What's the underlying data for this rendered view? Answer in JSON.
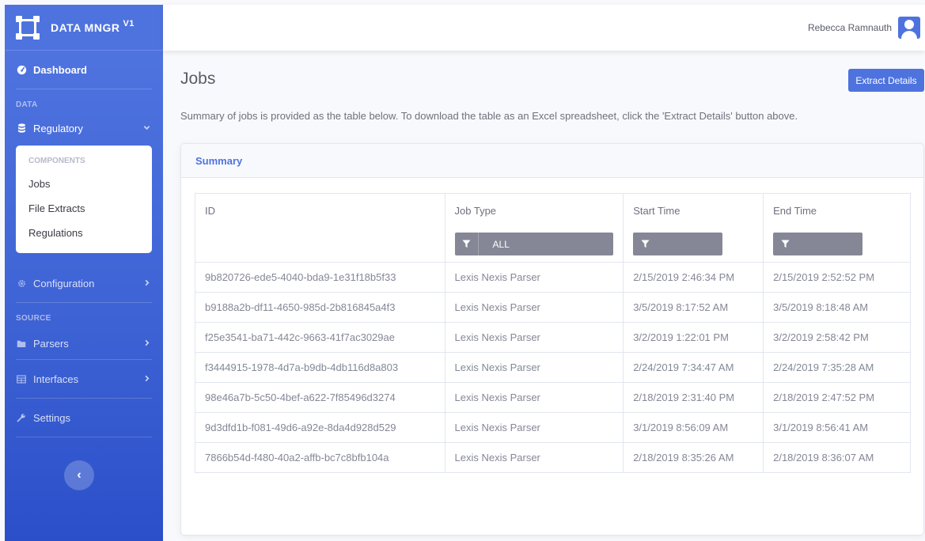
{
  "brand": {
    "name": "DATA MNGR",
    "version": "V1"
  },
  "sidebar": {
    "dashboard": "Dashboard",
    "section_data": "DATA",
    "regulatory": "Regulatory",
    "components_head": "COMPONENTS",
    "components": [
      "Jobs",
      "File Extracts",
      "Regulations"
    ],
    "configuration": "Configuration",
    "section_source": "SOURCE",
    "parsers": "Parsers",
    "interfaces": "Interfaces",
    "settings": "Settings",
    "toggle": "‹"
  },
  "topbar": {
    "user_name": "Rebecca Ramnauth"
  },
  "page": {
    "title": "Jobs",
    "extract_button": "Extract Details",
    "description": "Summary of jobs is provided as the table below. To download the table as an Excel spreadsheet, click the 'Extract Details' button above."
  },
  "card": {
    "title": "Summary"
  },
  "table": {
    "headers": [
      "ID",
      "Job Type",
      "Start Time",
      "End Time"
    ],
    "filters": {
      "job_type": "ALL",
      "start_time": "",
      "end_time": ""
    },
    "rows": [
      [
        "9b820726-ede5-4040-bda9-1e31f18b5f33",
        "Lexis Nexis Parser",
        "2/15/2019 2:46:34 PM",
        "2/15/2019 2:52:52 PM"
      ],
      [
        "b9188a2b-df11-4650-985d-2b816845a4f3",
        "Lexis Nexis Parser",
        "3/5/2019 8:17:52 AM",
        "3/5/2019 8:18:48 AM"
      ],
      [
        "f25e3541-ba71-442c-9663-41f7ac3029ae",
        "Lexis Nexis Parser",
        "3/2/2019 1:22:01 PM",
        "3/2/2019 2:58:42 PM"
      ],
      [
        "f3444915-1978-4d7a-b9db-4db116d8a803",
        "Lexis Nexis Parser",
        "2/24/2019 7:34:47 AM",
        "2/24/2019 7:35:28 AM"
      ],
      [
        "98e46a7b-5c50-4bef-a622-7f85496d3274",
        "Lexis Nexis Parser",
        "2/18/2019 2:31:40 PM",
        "2/18/2019 2:47:52 PM"
      ],
      [
        "9d3dfd1b-f081-49d6-a92e-8da4d928d529",
        "Lexis Nexis Parser",
        "3/1/2019 8:56:09 AM",
        "3/1/2019 8:56:41 AM"
      ],
      [
        "7866b54d-f480-40a2-affb-bc7c8bfb104a",
        "Lexis Nexis Parser",
        "2/18/2019 8:35:26 AM",
        "2/18/2019 8:36:07 AM"
      ]
    ]
  },
  "colors": {
    "primary": "#4e73df",
    "sidebar_gradient_end": "#2b4fc9",
    "filter_bg": "#858796",
    "text_muted": "#858796"
  },
  "icons": {
    "brand": "vector-square-icon",
    "dashboard": "tachometer-icon",
    "regulatory": "database-icon",
    "configuration": "cog-icon",
    "parsers": "folder-icon",
    "interfaces": "table-icon",
    "settings": "wrench-icon",
    "filter": "filter-icon",
    "user": "user-icon"
  }
}
